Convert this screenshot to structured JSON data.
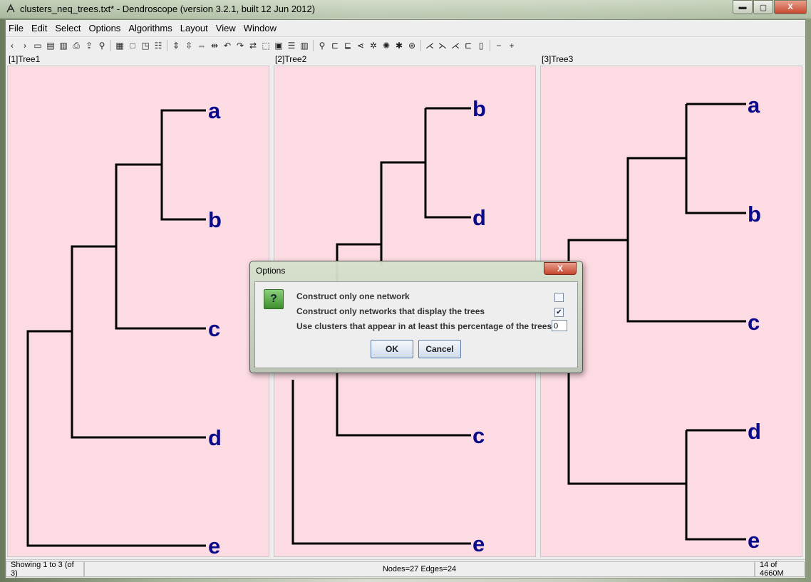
{
  "window": {
    "title": "clusters_neq_trees.txt* - Dendroscope (version 3.2.1, built 12 Jun 2012)",
    "controls": {
      "minimize": "▬",
      "maximize": "▢",
      "close": "X"
    }
  },
  "menu": [
    "File",
    "Edit",
    "Select",
    "Options",
    "Algorithms",
    "Layout",
    "View",
    "Window"
  ],
  "panels": [
    {
      "title": "[1]Tree1",
      "leaves": [
        "a",
        "b",
        "c",
        "d",
        "e"
      ]
    },
    {
      "title": "[2]Tree2",
      "leaves": [
        "b",
        "d",
        "c",
        "e"
      ]
    },
    {
      "title": "[3]Tree3",
      "leaves": [
        "a",
        "b",
        "c",
        "d",
        "e"
      ]
    }
  ],
  "status": {
    "showing": "Showing 1 to 3 (of 3)",
    "counts": "Nodes=27 Edges=24",
    "memory": "14 of 4660M"
  },
  "dialog": {
    "title": "Options",
    "icon": "?",
    "option1": {
      "label": "Construct only one network",
      "checked": false
    },
    "option2": {
      "label": "Construct only networks that display the trees",
      "checked": true
    },
    "option3": {
      "label": "Use clusters that appear in at least this percentage of the trees",
      "value": "0"
    },
    "ok": "OK",
    "cancel": "Cancel",
    "close": "X"
  },
  "colors": {
    "canvas": "#fddbe3",
    "edge": "#000000",
    "label": "#0a0a8a"
  }
}
